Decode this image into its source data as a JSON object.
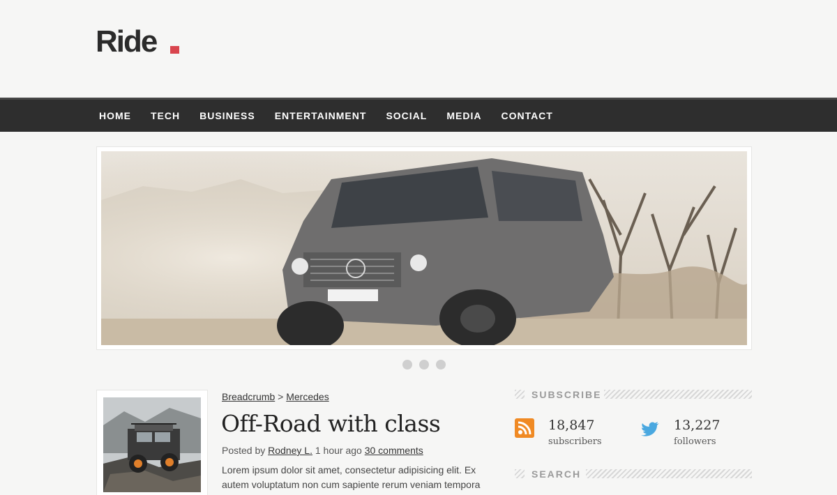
{
  "site": {
    "logo_text": "Ride",
    "accent_color": "#d9454e"
  },
  "nav": {
    "items": [
      "HOME",
      "TECH",
      "BUSINESS",
      "ENTERTAINMENT",
      "SOCIAL",
      "MEDIA",
      "CONTACT"
    ]
  },
  "slider": {
    "image_icon": "suv-photo",
    "dot_count": 3
  },
  "post": {
    "thumb_icon": "offroad-truck-photo",
    "breadcrumb_root": "Breadcrumb",
    "breadcrumb_sep": ">",
    "breadcrumb_current": "Mercedes",
    "title": "Off-Road with class",
    "meta_prefix": "Posted by",
    "author": "Rodney L.",
    "time": "1 hour ago",
    "comments": "30 comments",
    "excerpt": "Lorem ipsum dolor sit amet, consectetur adipisicing elit. Ex autem voluptatum non cum sapiente rerum veniam tempora"
  },
  "sidebar": {
    "subscribe_title": "SUBSCRIBE",
    "rss_count": "18,847",
    "rss_label": "subscribers",
    "rss_color": "#f08a24",
    "twitter_count": "13,227",
    "twitter_label": "followers",
    "twitter_color": "#4aa8e0",
    "search_title": "SEARCH"
  }
}
